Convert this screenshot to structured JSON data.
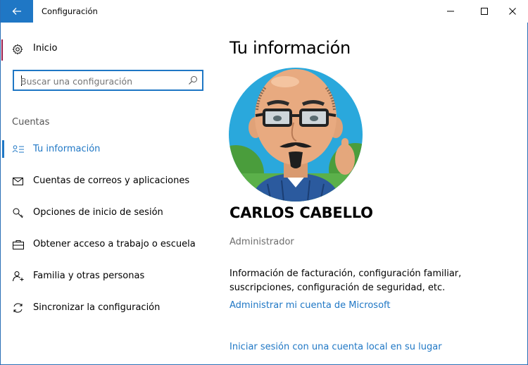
{
  "window": {
    "title": "Configuración",
    "accent_color": "#1f77c5"
  },
  "titlebar": {
    "back_icon": "arrow-left-icon",
    "minimize_icon": "minimize-icon",
    "maximize_icon": "maximize-icon",
    "close_icon": "close-icon"
  },
  "sidebar": {
    "home_label": "Inicio",
    "search": {
      "placeholder": "Buscar una configuración",
      "value": ""
    },
    "section_title": "Cuentas",
    "items": [
      {
        "label": "Tu información",
        "icon": "user-info-icon",
        "active": true
      },
      {
        "label": "Cuentas de correos y aplicaciones",
        "icon": "mail-icon",
        "active": false
      },
      {
        "label": "Opciones de inicio de sesión",
        "icon": "key-icon",
        "active": false
      },
      {
        "label": "Obtener acceso a trabajo o escuela",
        "icon": "briefcase-icon",
        "active": false
      },
      {
        "label": "Familia y otras personas",
        "icon": "person-add-icon",
        "active": false
      },
      {
        "label": "Sincronizar la configuración",
        "icon": "sync-icon",
        "active": false
      }
    ]
  },
  "main": {
    "title": "Tu información",
    "user_name": "CARLOS CABELLO",
    "user_role": "Administrador",
    "info_text": "Información de facturación, configuración familiar, suscripciones, configuración de seguridad, etc.",
    "manage_link": "Administrar mi cuenta de Microsoft",
    "local_link": "Iniciar sesión con una cuenta local en su lugar"
  }
}
